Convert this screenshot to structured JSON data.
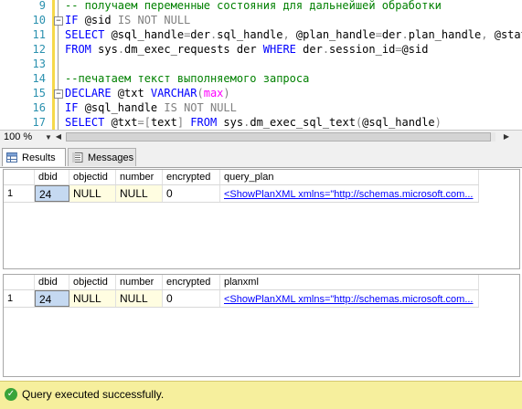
{
  "editor": {
    "lines": [
      {
        "n": "9",
        "parts": [
          {
            "c": "cm",
            "t": "-- получаем переменные состояния для дальнейшей обработки"
          }
        ]
      },
      {
        "n": "10",
        "parts": [
          {
            "c": "kw",
            "t": "IF "
          },
          {
            "c": "tx",
            "t": "@sid "
          },
          {
            "c": "gr",
            "t": "IS NOT NULL"
          }
        ]
      },
      {
        "n": "11",
        "parts": [
          {
            "c": "kw",
            "t": "SELECT "
          },
          {
            "c": "tx",
            "t": "@sql_handle"
          },
          {
            "c": "gr",
            "t": "="
          },
          {
            "c": "tx",
            "t": "der"
          },
          {
            "c": "gr",
            "t": "."
          },
          {
            "c": "tx",
            "t": "sql_handle"
          },
          {
            "c": "gr",
            "t": ", "
          },
          {
            "c": "tx",
            "t": "@plan_handle"
          },
          {
            "c": "gr",
            "t": "="
          },
          {
            "c": "tx",
            "t": "der"
          },
          {
            "c": "gr",
            "t": "."
          },
          {
            "c": "tx",
            "t": "plan_handle"
          },
          {
            "c": "gr",
            "t": ", "
          },
          {
            "c": "tx",
            "t": "@statem"
          }
        ]
      },
      {
        "n": "12",
        "parts": [
          {
            "c": "kw",
            "t": "FROM "
          },
          {
            "c": "tx",
            "t": "sys"
          },
          {
            "c": "gr",
            "t": "."
          },
          {
            "c": "tx",
            "t": "dm_exec_requests der "
          },
          {
            "c": "kw",
            "t": "WHERE "
          },
          {
            "c": "tx",
            "t": "der"
          },
          {
            "c": "gr",
            "t": "."
          },
          {
            "c": "tx",
            "t": "session_id"
          },
          {
            "c": "gr",
            "t": "="
          },
          {
            "c": "tx",
            "t": "@sid"
          }
        ]
      },
      {
        "n": "13",
        "parts": []
      },
      {
        "n": "14",
        "parts": [
          {
            "c": "cm",
            "t": "--печатаем текст выполняемого запроса"
          }
        ]
      },
      {
        "n": "15",
        "parts": [
          {
            "c": "kw",
            "t": "DECLARE "
          },
          {
            "c": "tx",
            "t": "@txt "
          },
          {
            "c": "kw",
            "t": "VARCHAR"
          },
          {
            "c": "gr",
            "t": "("
          },
          {
            "c": "fn",
            "t": "max"
          },
          {
            "c": "gr",
            "t": ")"
          }
        ]
      },
      {
        "n": "16",
        "parts": [
          {
            "c": "kw",
            "t": "IF "
          },
          {
            "c": "tx",
            "t": "@sql_handle "
          },
          {
            "c": "gr",
            "t": "IS NOT NULL"
          }
        ]
      },
      {
        "n": "17",
        "parts": [
          {
            "c": "kw",
            "t": "SELECT "
          },
          {
            "c": "tx",
            "t": "@txt"
          },
          {
            "c": "gr",
            "t": "=["
          },
          {
            "c": "tx",
            "t": "text"
          },
          {
            "c": "gr",
            "t": "] "
          },
          {
            "c": "kw",
            "t": "FROM "
          },
          {
            "c": "tx",
            "t": "sys"
          },
          {
            "c": "gr",
            "t": "."
          },
          {
            "c": "tx",
            "t": "dm_exec_sql_text"
          },
          {
            "c": "gr",
            "t": "("
          },
          {
            "c": "tx",
            "t": "@sql_handle"
          },
          {
            "c": "gr",
            "t": ")"
          }
        ]
      }
    ]
  },
  "zoom": {
    "value": "100 %"
  },
  "tabs": {
    "results": "Results",
    "messages": "Messages"
  },
  "grid1": {
    "headers": [
      "dbid",
      "objectid",
      "number",
      "encrypted",
      "query_plan"
    ],
    "rows": [
      {
        "num": "1",
        "dbid": "24",
        "objectid": "NULL",
        "number": "NULL",
        "encrypted": "0",
        "value": "<ShowPlanXML xmlns=\"http://schemas.microsoft.com..."
      }
    ]
  },
  "grid2": {
    "headers": [
      "dbid",
      "objectid",
      "number",
      "encrypted",
      "planxml"
    ],
    "rows": [
      {
        "num": "1",
        "dbid": "24",
        "objectid": "NULL",
        "number": "NULL",
        "encrypted": "0",
        "value": "<ShowPlanXML xmlns=\"http://schemas.microsoft.com..."
      }
    ]
  },
  "status": {
    "text": "Query executed successfully."
  },
  "colors": {
    "status_bar": "#f6ef9d",
    "selected_cell": "#c5d9f1",
    "null_cell": "#fffde1",
    "comment": "#008000",
    "keyword": "#0000ff"
  }
}
